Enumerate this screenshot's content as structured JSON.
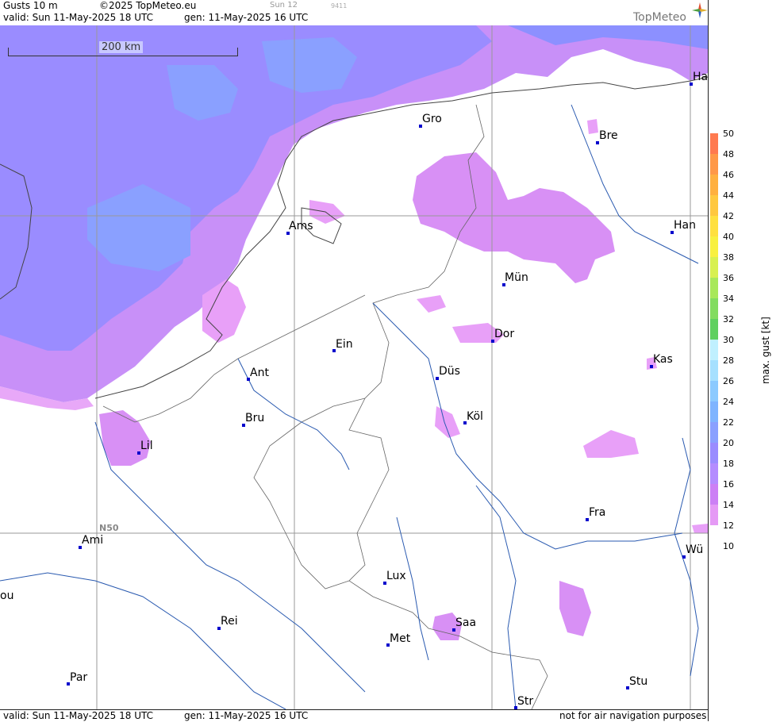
{
  "header": {
    "product": "Gusts 10 m",
    "copyright": "©2025 TopMeteo.eu",
    "day_tab": "Sun 12",
    "code": "9411",
    "valid": "valid:  Sun  11-May-2025  18 UTC",
    "gen": "gen: 11-May-2025 16 UTC",
    "logo": "TopMeteo"
  },
  "footer": {
    "valid": "valid:  Sun  11-May-2025  18 UTC",
    "gen": "gen: 11-May-2025 16 UTC",
    "note": "not for air navigation purposes"
  },
  "map": {
    "scale_label": "200 km",
    "lat_label": "N50",
    "cities": [
      {
        "name": "Gro"
      },
      {
        "name": "Bre"
      },
      {
        "name": "Ha"
      },
      {
        "name": "Ams"
      },
      {
        "name": "Han"
      },
      {
        "name": "Mün"
      },
      {
        "name": "Dor"
      },
      {
        "name": "Ein"
      },
      {
        "name": "Kas"
      },
      {
        "name": "Düs"
      },
      {
        "name": "Ant"
      },
      {
        "name": "Köl"
      },
      {
        "name": "Bru"
      },
      {
        "name": "Lil"
      },
      {
        "name": "Fra"
      },
      {
        "name": "Ami"
      },
      {
        "name": "Wü"
      },
      {
        "name": "Lux"
      },
      {
        "name": "ou"
      },
      {
        "name": "Rei"
      },
      {
        "name": "Saa"
      },
      {
        "name": "Met"
      },
      {
        "name": "Stu"
      },
      {
        "name": "Par"
      },
      {
        "name": "Str"
      }
    ]
  },
  "legend": {
    "title": "max. gust [kt]",
    "ticks": [
      "50",
      "48",
      "46",
      "44",
      "42",
      "40",
      "38",
      "36",
      "34",
      "32",
      "30",
      "28",
      "26",
      "24",
      "22",
      "20",
      "18",
      "16",
      "14",
      "12",
      "10"
    ],
    "colors": {
      "12-14": "#e59af5",
      "14-16": "#cc80f5",
      "16-18": "#b48cff",
      "18-20": "#9a8cff",
      "20-22": "#8aa0ff",
      "22-24": "#7fb4ff",
      "24-26": "#8ccaff",
      "26-28": "#a6e0ff",
      "28-30": "#c0f0ff",
      "30-32": "#5fd060",
      "32-34": "#82dc60",
      "34-36": "#a8e85a",
      "36-38": "#d8f050",
      "38-40": "#f8f040",
      "40-42": "#ffe040",
      "42-44": "#ffc840",
      "44-46": "#ffb040",
      "46-48": "#ff9848",
      "48-50": "#ff7a50"
    }
  }
}
